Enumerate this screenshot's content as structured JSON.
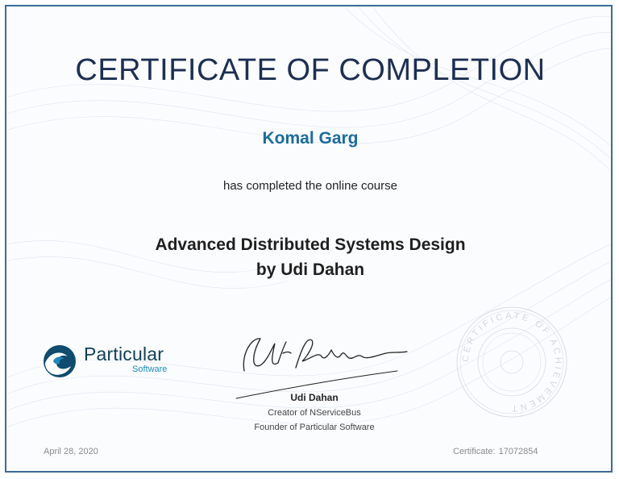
{
  "certificate": {
    "title": "CERTIFICATE OF COMPLETION",
    "recipient": "Komal Garg",
    "completed_text": "has completed the online course",
    "course_line1": "Advanced Distributed Systems Design",
    "course_line2": "by Udi Dahan"
  },
  "logo": {
    "name": "Particular",
    "sub": "Software",
    "icon": "particular-wave-logo"
  },
  "signer": {
    "name": "Udi Dahan",
    "role1": "Creator of NServiceBus",
    "role2": "Founder of Particular Software"
  },
  "seal": {
    "text": "CERTIFICATE OF ACHIEVEMENT"
  },
  "footer": {
    "date": "April 28, 2020",
    "certificate_label": "Certificate:",
    "certificate_number": "17072854"
  },
  "colors": {
    "border": "#3e6a96",
    "title": "#1d2f52",
    "recipient": "#1a6c9c",
    "logo_dark": "#0f3f59",
    "logo_accent": "#1d88b9"
  }
}
